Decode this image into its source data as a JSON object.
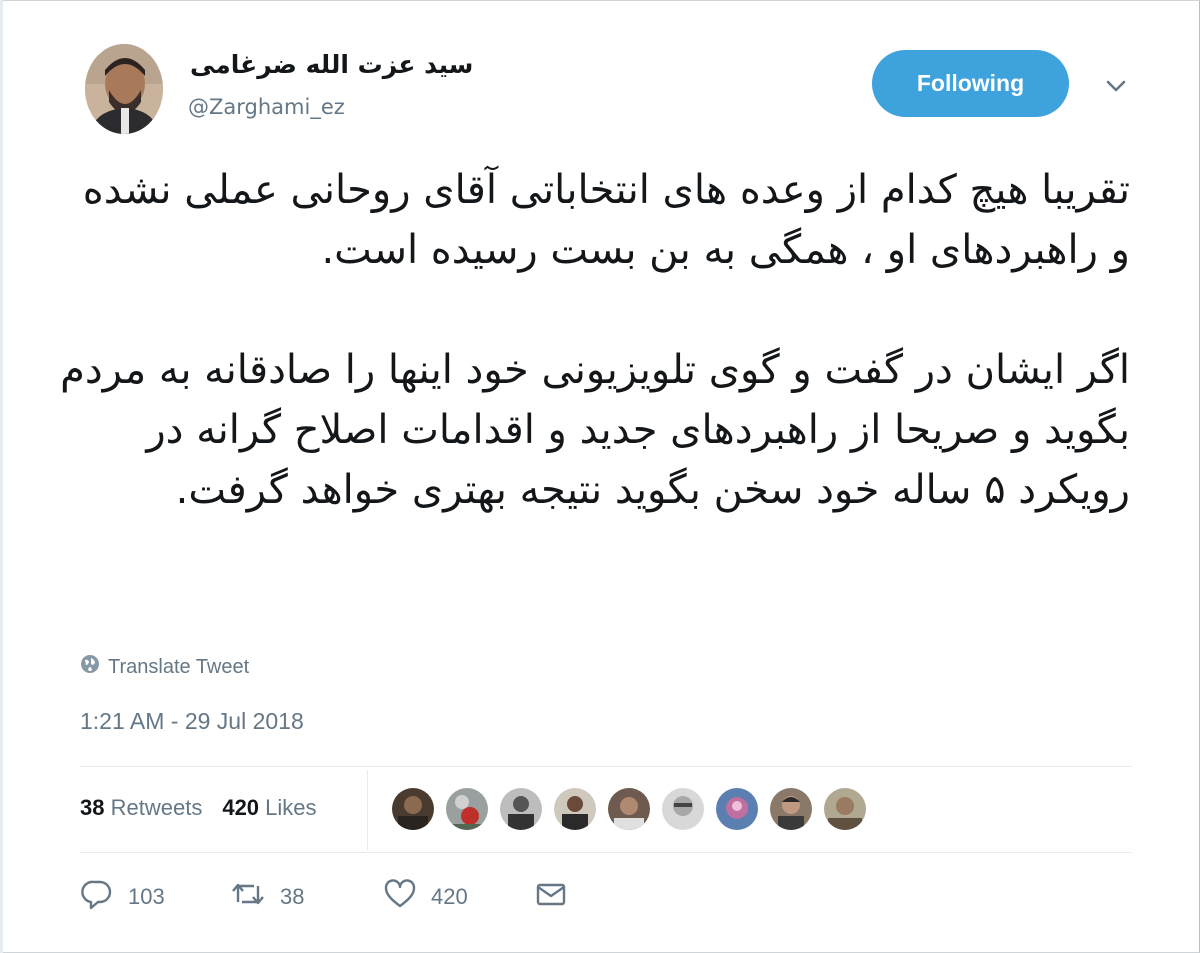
{
  "user": {
    "name": "سید عزت الله ضرغامی",
    "handle": "@Zarghami_ez"
  },
  "follow_button": {
    "label": "Following"
  },
  "tweet": {
    "paragraphs": [
      "تقریبا هیچ کدام از وعده های انتخاباتی آقای روحانی عملی نشده و راهبردهای او ، همگی به بن بست رسیده است.",
      "اگر ایشان در گفت و گوی تلویزیونی خود اینها را صادقانه به مردم بگوید و صریحا از راهبردهای جدید و اقدامات اصلاح گرانه در رویکرد ۵ ساله خود سخن بگوید نتیجه بهتری خواهد گرفت."
    ],
    "translate_label": "Translate Tweet",
    "timestamp": "1:21 AM - 29 Jul 2018"
  },
  "stats": {
    "retweets_count": "38",
    "retweets_label": "Retweets",
    "likes_count": "420",
    "likes_label": "Likes"
  },
  "actions": {
    "reply_count": "103",
    "retweet_count": "38",
    "like_count": "420"
  },
  "colors": {
    "accent": "#3ea2dc",
    "secondary_text": "#657786",
    "primary_text": "#14171a"
  }
}
